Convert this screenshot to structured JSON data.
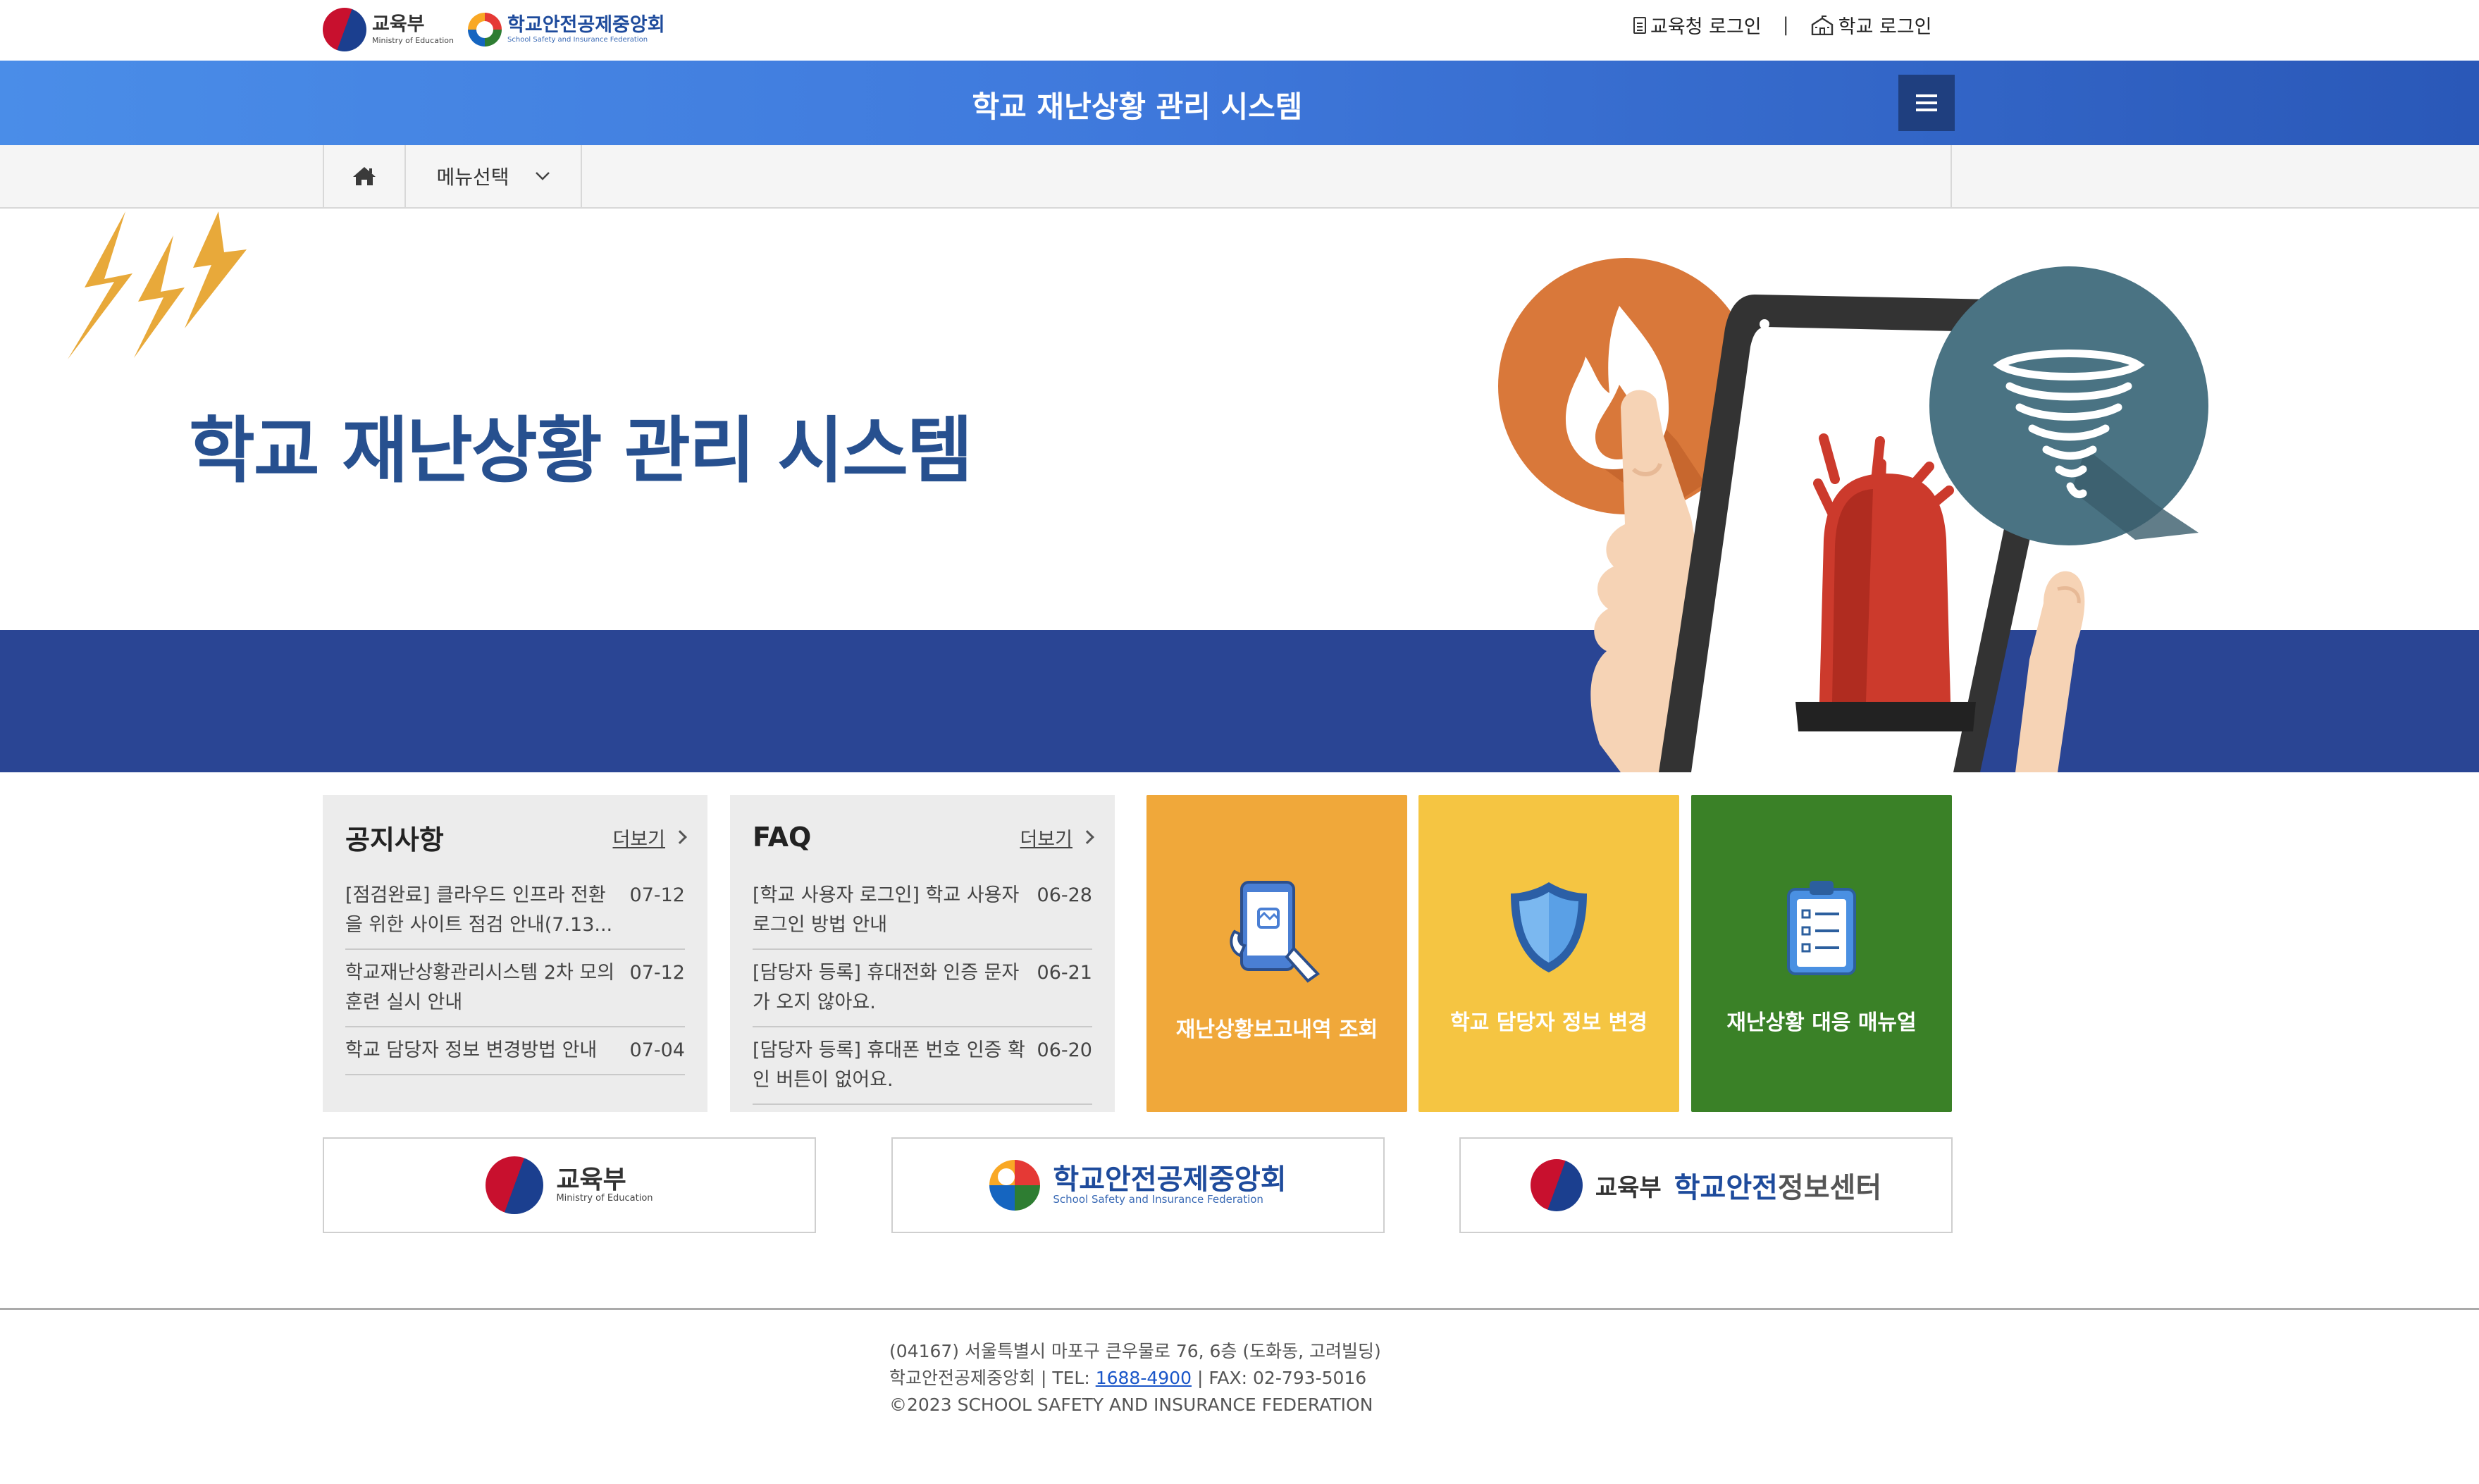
{
  "top": {
    "moe_logo_ko": "교육부",
    "moe_logo_en": "Ministry of Education",
    "ssif_logo_ko": "학교안전공제중앙회",
    "ssif_logo_en": "School Safety and Insurance Federation",
    "edu_office_login": "교육청 로그인",
    "separator": "|",
    "school_login": "학교 로그인"
  },
  "header": {
    "title": "학교 재난상황 관리 시스템",
    "menu_icon": "hamburger-icon"
  },
  "nav": {
    "home_icon": "home-icon",
    "menu_select": "메뉴선택"
  },
  "hero": {
    "title": "학교 재난상황 관리 시스템"
  },
  "notice": {
    "title": "공지사항",
    "more": "더보기",
    "items": [
      {
        "title": "[점검완료] 클라우드 인프라 전환을 위한 사이트 점검 안내(7.13...",
        "date": "07-12"
      },
      {
        "title": "학교재난상황관리시스템 2차 모의 훈련 실시 안내",
        "date": "07-12"
      },
      {
        "title": "학교 담당자 정보 변경방법 안내",
        "date": "07-04"
      }
    ]
  },
  "faq": {
    "title": "FAQ",
    "more": "더보기",
    "items": [
      {
        "title": "[학교 사용자 로그인] 학교 사용자 로그인 방법 안내",
        "date": "06-28"
      },
      {
        "title": "[담당자 등록] 휴대전화 인증 문자가 오지 않아요.",
        "date": "06-21"
      },
      {
        "title": "[담당자 등록] 휴대폰 번호 인증 확인 버튼이 없어요.",
        "date": "06-20"
      }
    ]
  },
  "tiles": [
    {
      "label": "재난상황보고내역 조회",
      "icon": "phone-report-icon",
      "color": "#f0a83a"
    },
    {
      "label": "학교 담당자 정보 변경",
      "icon": "shield-icon",
      "color": "#f5c542"
    },
    {
      "label": "재난상황 대응 매뉴얼",
      "icon": "clipboard-icon",
      "color": "#3a8127"
    }
  ],
  "banners": {
    "moe_ko": "교육부",
    "moe_en": "Ministry of Education",
    "ssif_ko": "학교안전공제중앙회",
    "ssif_en": "School Safety and Insurance Federation",
    "safety_prefix": "교육부",
    "safety_blue": "학교안전",
    "safety_rest": "정보센터"
  },
  "footer": {
    "address": "(04167) 서울특별시 마포구 큰우물로 76, 6층 (도화동, 고려빌딩)",
    "org": "학교안전공제중앙회",
    "tel_label": "| TEL:",
    "tel": "1688-4900",
    "fax_label": "| FAX:",
    "fax": "02-793-5016",
    "copyright": "©2023 SCHOOL SAFETY AND INSURANCE FEDERATION"
  },
  "colors": {
    "header_blue": "#3f79dc",
    "hero_band": "#2a4594",
    "hero_title": "#27508f"
  }
}
